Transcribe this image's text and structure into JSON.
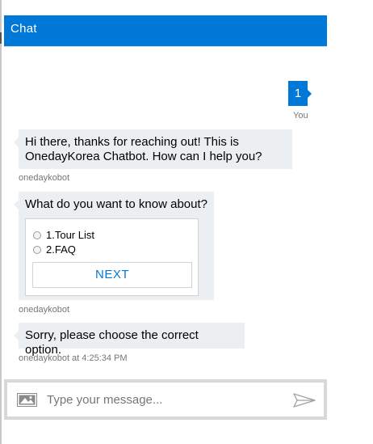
{
  "header": {
    "title": "Chat"
  },
  "messages": {
    "user": {
      "text": "1",
      "from": "You"
    },
    "bot_greeting": {
      "text": "Hi there, thanks for reaching out! This is OnedayKorea Chatbot. How can I help you?",
      "from": "onedaykobot"
    },
    "bot_choice": {
      "question": "What do you want to know about?",
      "options": [
        "1.Tour List",
        "2.FAQ"
      ],
      "button_label": "NEXT",
      "from": "onedaykobot"
    },
    "bot_error": {
      "text": "Sorry, please choose the correct option.",
      "from": "onedaykobot at 4:25:34 PM"
    }
  },
  "composer": {
    "placeholder": "Type your message...",
    "upload_icon": "image-icon",
    "send_icon": "send-icon"
  },
  "colors": {
    "accent": "#0078d7",
    "bubble_bg": "#eceff1",
    "meta_text": "#767676"
  }
}
